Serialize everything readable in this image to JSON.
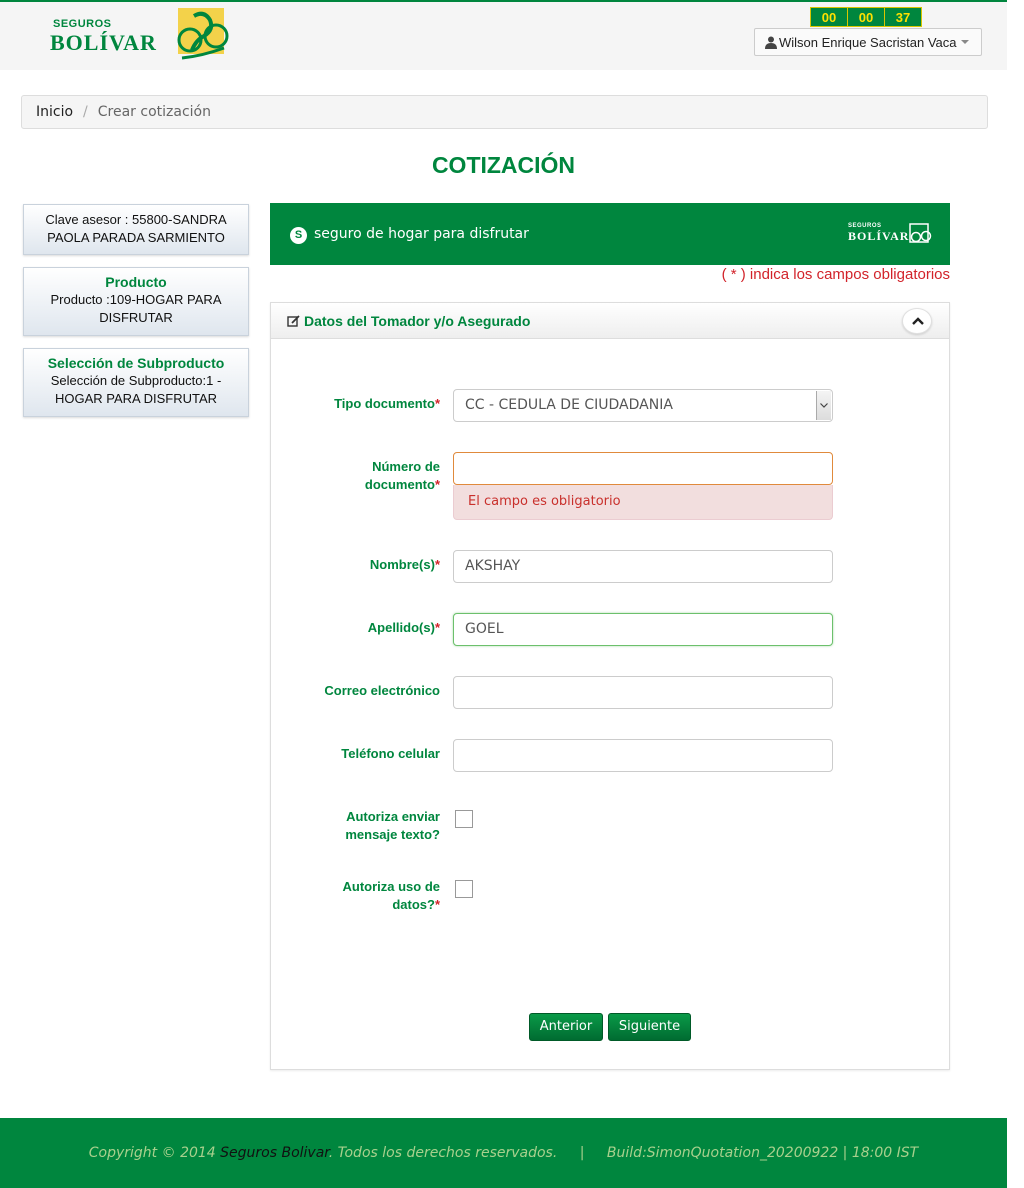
{
  "header": {
    "brand_small": "SEGUROS",
    "brand_main": "BOLÍVAR",
    "timer": {
      "hours": "00",
      "minutes": "00",
      "seconds": "37"
    },
    "user_name": "Wilson Enrique Sacristan Vaca"
  },
  "breadcrumb": {
    "home": "Inicio",
    "separator": "/",
    "current": "Crear cotización"
  },
  "page_title": "COTIZACIÓN",
  "sidebar": {
    "advisor": "Clave asesor : 55800-SANDRA PAOLA PARADA SARMIENTO",
    "product_title": "Producto",
    "product_value": "Producto :109-HOGAR PARA DISFRUTAR",
    "subproduct_title": "Selección de Subproducto",
    "subproduct_value": "Selección de Subproducto:1 - HOGAR PARA DISFRUTAR"
  },
  "banner": {
    "icon_letter": "S",
    "tagline": "seguro de hogar para disfrutar",
    "brand_small": "SEGUROS",
    "brand_main": "BOLÍVAR"
  },
  "required_note": "( * ) indica los campos obligatorios",
  "panel": {
    "title": "Datos del Tomador y/o Asegurado"
  },
  "form": {
    "required_mark": "*",
    "tipo_documento": {
      "label": "Tipo documento",
      "value": "CC - CEDULA DE CIUDADANIA"
    },
    "numero_documento": {
      "label_line1": "Número de",
      "label_line2": "documento",
      "value": "",
      "error": "El campo es obligatorio"
    },
    "nombres": {
      "label": "Nombre(s)",
      "value": "AKSHAY"
    },
    "apellidos": {
      "label": "Apellido(s)",
      "value": "GOEL"
    },
    "correo": {
      "label": "Correo electrónico",
      "value": ""
    },
    "telefono": {
      "label": "Teléfono celular",
      "value": ""
    },
    "autoriza_mensaje": {
      "label_line1": "Autoriza enviar",
      "label_line2": "mensaje texto?",
      "checked": false
    },
    "autoriza_datos": {
      "label_line1": "Autoriza uso de",
      "label_line2": "datos?",
      "checked": false
    }
  },
  "buttons": {
    "previous": "Anterior",
    "next": "Siguiente"
  },
  "footer": {
    "copyright_prefix": "Copyright © 2014",
    "company": "Seguros Bolivar",
    "rights": ". Todos los derechos reservados.",
    "separator": "|",
    "build": "Build:SimonQuotation_20200922 | 18:00 IST"
  },
  "colors": {
    "brand_green": "#00863e",
    "timer_text": "#ffe000",
    "error_red": "#d2232a"
  }
}
